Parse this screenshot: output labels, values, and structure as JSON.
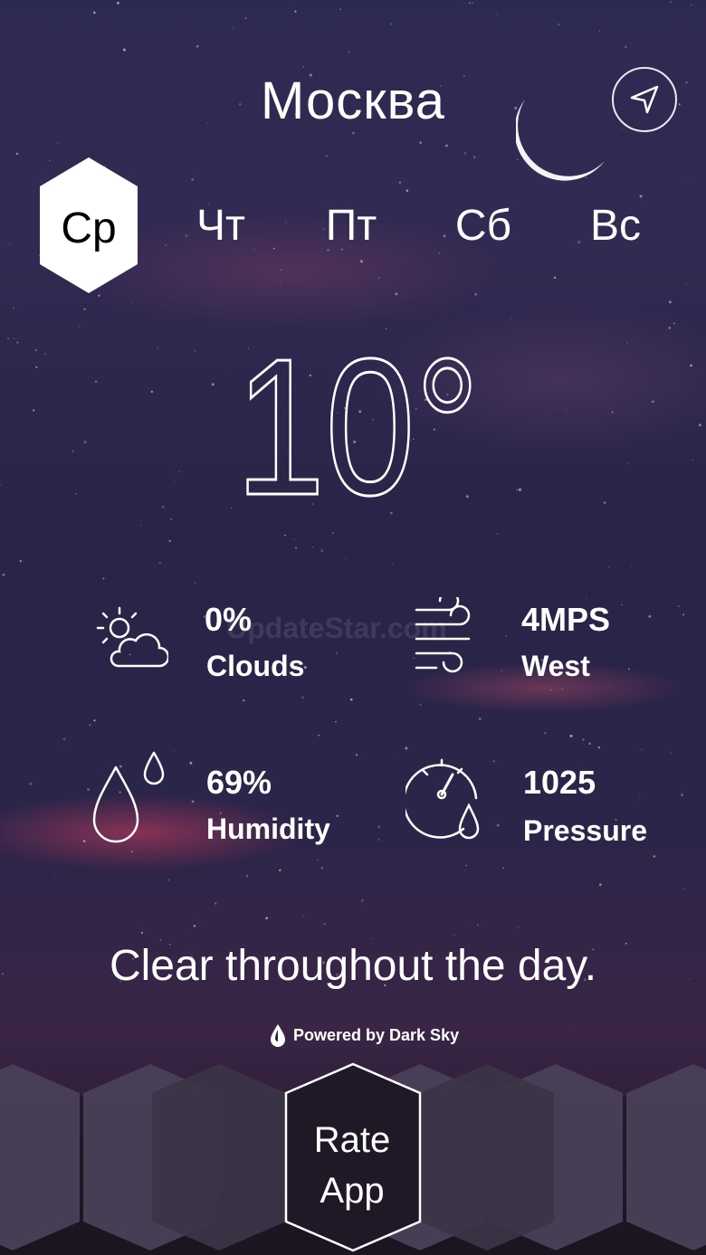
{
  "location": {
    "city": "Москва"
  },
  "days": [
    {
      "label": "Ср",
      "active": true
    },
    {
      "label": "Чт",
      "active": false
    },
    {
      "label": "Пт",
      "active": false
    },
    {
      "label": "Сб",
      "active": false
    },
    {
      "label": "Вс",
      "active": false
    }
  ],
  "current": {
    "temperature": "10°"
  },
  "stats": {
    "clouds": {
      "value": "0%",
      "label": "Clouds",
      "icon": "partly-cloudy-icon"
    },
    "wind": {
      "value": "4MPS",
      "label": "West",
      "icon": "wind-icon"
    },
    "humidity": {
      "value": "69%",
      "label": "Humidity",
      "icon": "humidity-drops-icon"
    },
    "pressure": {
      "value": "1025",
      "label": "Pressure",
      "icon": "pressure-gauge-icon"
    }
  },
  "summary": "Clear throughout the day.",
  "attribution": "Powered by Dark Sky",
  "rate_app": {
    "line1": "Rate",
    "line2": "App"
  },
  "watermark": "UpdateStar.com",
  "colors": {
    "hex_fill": "#4a4058",
    "text": "#ffffff",
    "active_day_bg": "#ffffff"
  }
}
